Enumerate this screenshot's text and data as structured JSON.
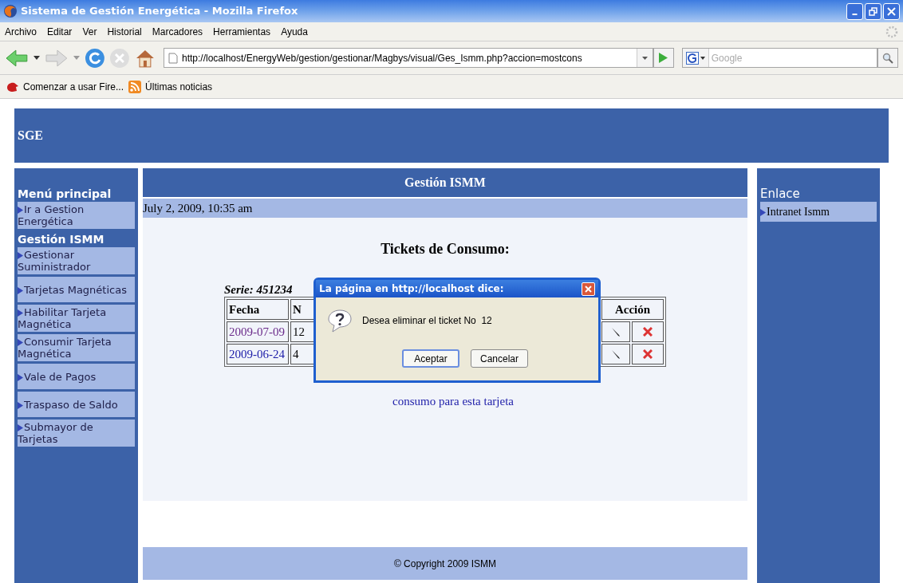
{
  "window": {
    "title": "Sistema de Gestión Energética - Mozilla Firefox"
  },
  "menu": [
    "Archivo",
    "Editar",
    "Ver",
    "Historial",
    "Marcadores",
    "Herramientas",
    "Ayuda"
  ],
  "url": "http://localhost/EnergyWeb/gestion/gestionar/Magbys/visual/Ges_Ismm.php?accion=mostcons",
  "search": {
    "placeholder": "Google"
  },
  "bookmarks": [
    "Comenzar a usar Fire...",
    "Últimas noticias"
  ],
  "banner": "SGE",
  "left_menu": [
    {
      "kind": "heading",
      "label": "Menú principal"
    },
    {
      "kind": "link",
      "label": "Ir a Gestion Energética"
    },
    {
      "kind": "heading",
      "label": "Gestión ISMM"
    },
    {
      "kind": "link",
      "label": "Gestionar Suministrador"
    },
    {
      "kind": "link",
      "label": "Tarjetas Magnéticas"
    },
    {
      "kind": "link",
      "label": "Habilitar Tarjeta Magnética"
    },
    {
      "kind": "link",
      "label": "Consumir Tarjeta Magnética"
    },
    {
      "kind": "link",
      "label": "Vale de Pagos"
    },
    {
      "kind": "link",
      "label": "Traspaso de Saldo"
    },
    {
      "kind": "link",
      "label": "Submayor de Tarjetas"
    }
  ],
  "content": {
    "heading": "Gestión ISMM",
    "date": "July 2, 2009, 10:35 am",
    "title": "Tickets de Consumo:",
    "serie": "Serie: 451234",
    "table": {
      "columns": [
        "Fecha",
        "N",
        "Acción"
      ],
      "rows": [
        {
          "date": "2009-07-09",
          "visited": true,
          "number": "12"
        },
        {
          "date": "2009-06-24",
          "visited": false,
          "number": "4"
        }
      ]
    },
    "link": "consumo para esta tarjeta"
  },
  "footer": "© Copyright 2009 ISMM",
  "right_menu": {
    "title": "Enlace",
    "items": [
      "Intranet Ismm"
    ]
  },
  "dialog": {
    "title": "La página en http://localhost dice:",
    "message": "Desea eliminar el ticket No  12",
    "buttons": [
      {
        "label": "Aceptar",
        "focused": true
      },
      {
        "label": "Cancelar",
        "focused": false
      }
    ]
  }
}
